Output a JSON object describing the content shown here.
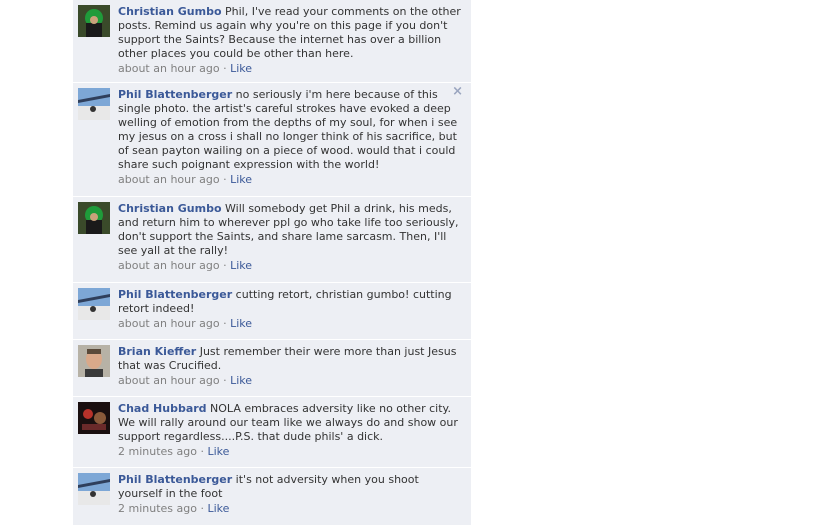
{
  "comments": [
    {
      "author": "Christian Gumbo",
      "text": "Phil, I've read your comments on the other posts. Remind us again why you're on this page if you don't support the Saints? Because the internet has over a billion other places you could be other than here.",
      "time": "about an hour ago",
      "like": "Like",
      "avatar": "christian-gumbo-avatar"
    },
    {
      "author": "Phil Blattenberger",
      "text": "no seriously i'm here because of this single photo. the artist's careful strokes have evoked a deep welling of emotion from the depths of my soul, for when i see my jesus on a cross i shall no longer think of his sacrifice, but of sean payton wailing on a piece of wood. would that i could share such poignant expression with the world!",
      "time": "about an hour ago",
      "like": "Like",
      "avatar": "phil-blattenberger-avatar",
      "close": "×"
    },
    {
      "author": "Christian Gumbo",
      "text": "Will somebody get Phil a drink, his meds, and return him to wherever ppl go who take life too seriously, don't support the Saints, and share lame sarcasm. Then, I'll see yall at the rally!",
      "time": "about an hour ago",
      "like": "Like",
      "avatar": "christian-gumbo-avatar"
    },
    {
      "author": "Phil Blattenberger",
      "text": "cutting retort, christian gumbo! cutting retort indeed!",
      "time": "about an hour ago",
      "like": "Like",
      "avatar": "phil-blattenberger-avatar"
    },
    {
      "author": "Brian Kieffer",
      "text": "Just remember their were more than just Jesus that was Crucified.",
      "time": "about an hour ago",
      "like": "Like",
      "avatar": "brian-kieffer-avatar"
    },
    {
      "author": "Chad Hubbard",
      "text": "NOLA embraces adversity like no other city. We will rally around our team like we always do and show our support regardless....P.S. that dude phils' a dick.",
      "time": "2 minutes ago",
      "like": "Like",
      "avatar": "chad-hubbard-avatar"
    },
    {
      "author": "Phil Blattenberger",
      "text": "it's not adversity when you shoot yourself in the foot",
      "time": "2 minutes ago",
      "like": "Like",
      "avatar": "phil-blattenberger-avatar"
    }
  ],
  "separator": " · "
}
